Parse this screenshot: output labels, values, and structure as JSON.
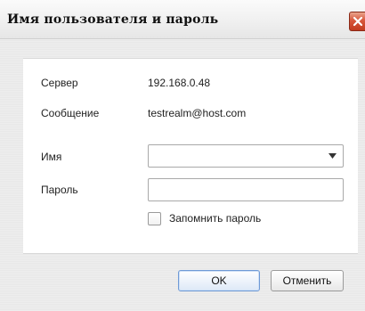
{
  "window": {
    "title": "Имя пользователя и пароль"
  },
  "fields": {
    "server": {
      "label": "Сервер",
      "value": "192.168.0.48"
    },
    "message": {
      "label": "Сообщение",
      "value": "testrealm@host.com"
    },
    "username": {
      "label": "Имя",
      "value": ""
    },
    "password": {
      "label": "Пароль",
      "value": ""
    }
  },
  "remember": {
    "label": "Запомнить пароль",
    "checked": false
  },
  "buttons": {
    "ok": "OK",
    "cancel": "Отменить"
  },
  "colors": {
    "close_button": "#d8573b",
    "ok_border": "#6f9ad6"
  },
  "icons": {
    "close": "close-icon",
    "dropdown": "chevron-down-icon"
  }
}
